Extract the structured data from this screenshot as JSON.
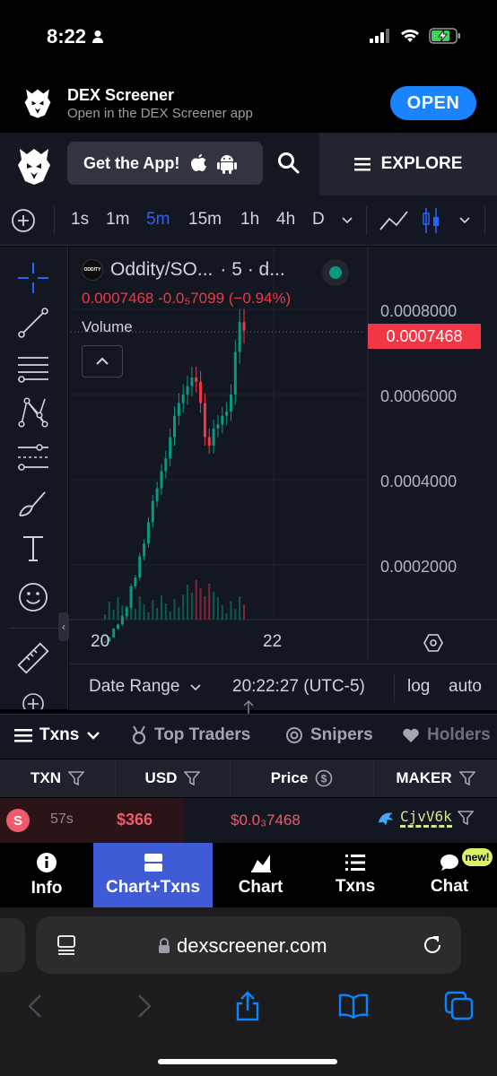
{
  "status": {
    "time": "8:22"
  },
  "banner": {
    "title": "DEX Screener",
    "subtitle": "Open in the DEX Screener app",
    "open_label": "OPEN"
  },
  "header": {
    "get_app_label": "Get the App!",
    "explore_label": "EXPLORE"
  },
  "toolbar": {
    "timeframes": [
      "1s",
      "1m",
      "5m",
      "15m",
      "1h",
      "4h",
      "D"
    ],
    "active_timeframe": "5m"
  },
  "chart": {
    "legend_logo_text": "ODDITY",
    "pair": "Oddity/SO...",
    "interval": "· 5 · d...",
    "price_line": "0.0007468  -0.0₅7099 (−0.94%)",
    "volume_label": "Volume",
    "last_price": "0.0007468",
    "price_axis": [
      "0.0008000",
      "0.0006000",
      "0.0004000",
      "0.0002000"
    ],
    "time_axis": [
      "20",
      "22"
    ]
  },
  "chart_data": {
    "type": "candlestick",
    "y_axis_ticks": [
      0.0002,
      0.0004,
      0.0006,
      0.0008
    ],
    "x_axis_ticks": [
      "20",
      "22"
    ],
    "last_price": 0.0007468,
    "change": "-0.0₅7099",
    "change_pct": -0.94,
    "approx_close_path": [
      2e-05,
      3e-05,
      5e-05,
      6e-05,
      8e-05,
      0.0001,
      0.00015,
      0.00017,
      0.00022,
      0.00025,
      0.0003,
      0.00035,
      0.00038,
      0.00042,
      0.00045,
      0.0005,
      0.00055,
      0.00058,
      0.0006,
      0.00062,
      0.00064,
      0.00063,
      0.00058,
      0.0005,
      0.00048,
      0.00052,
      0.00053,
      0.00055,
      0.00056,
      0.0006,
      0.0007,
      0.00077,
      0.00075
    ]
  },
  "range_bar": {
    "date_range": "Date Range",
    "time": "20:22:27 (UTC-5)",
    "log": "log",
    "auto": "auto"
  },
  "tabs": {
    "txns": "Txns",
    "top_traders": "Top Traders",
    "snipers": "Snipers",
    "holders": "Holders"
  },
  "table": {
    "headers": [
      "TXN",
      "USD",
      "Price",
      "MAKER"
    ],
    "row": {
      "type": "S",
      "age": "57s",
      "usd": "$366",
      "price": "$0.0₃7468",
      "maker": "CjvV6k"
    }
  },
  "bottom_nav": {
    "info": "Info",
    "chart_txns": "Chart+Txns",
    "chart": "Chart",
    "txns": "Txns",
    "chat": "Chat",
    "new_badge": "new!"
  },
  "safari": {
    "url": "dexscreener.com"
  },
  "colors": {
    "accent": "#2962ff",
    "down": "#f23645",
    "up": "#089981",
    "open_button": "#1a84ff",
    "active_nav": "#3f5bd5"
  }
}
